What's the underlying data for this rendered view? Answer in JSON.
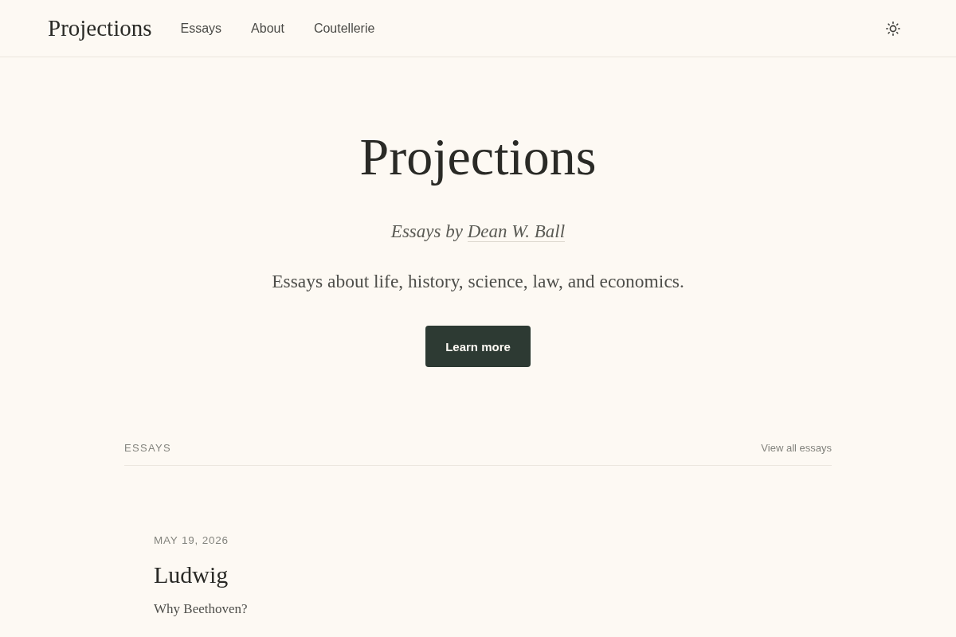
{
  "header": {
    "logo": "Projections",
    "nav": [
      {
        "label": "Essays"
      },
      {
        "label": "About"
      },
      {
        "label": "Coutellerie"
      }
    ]
  },
  "hero": {
    "title": "Projections",
    "byline": {
      "prefix": "Essays by",
      "author": "Dean W. Ball"
    },
    "tagline": "Essays about life, history, science, law, and economics.",
    "button": "Learn more"
  },
  "essays": {
    "heading": "ESSAYS",
    "view_all": "View all essays",
    "items": [
      {
        "date": "MAY 19, 2026",
        "title": "Ludwig",
        "summary": "Why Beethoven?"
      }
    ]
  }
}
